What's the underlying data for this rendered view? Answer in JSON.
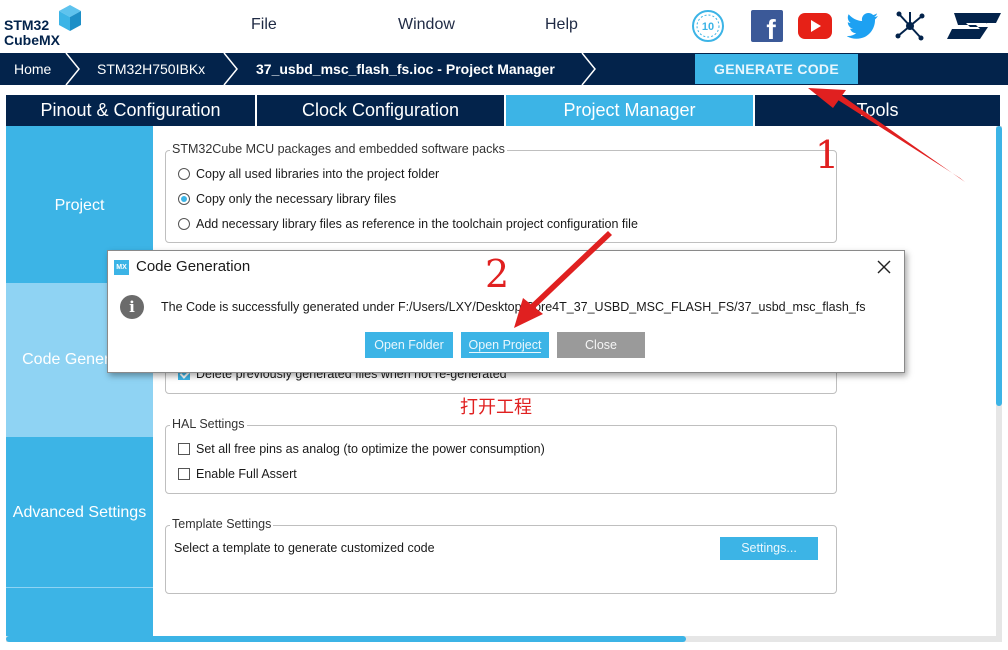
{
  "logo": {
    "line1": "STM32",
    "line2": "CubeMX"
  },
  "menu": {
    "file": "File",
    "window": "Window",
    "help": "Help"
  },
  "social": {
    "badge": "10",
    "facebook": "f",
    "st": "ST"
  },
  "breadcrumb": {
    "home": "Home",
    "device": "STM32H750IBKx",
    "project": "37_usbd_msc_flash_fs.ioc - Project Manager"
  },
  "toolbar": {
    "generate_label": "GENERATE CODE"
  },
  "tabs": [
    {
      "label": "Pinout & Configuration"
    },
    {
      "label": "Clock Configuration"
    },
    {
      "label": "Project Manager"
    },
    {
      "label": "Tools"
    }
  ],
  "sidenav": {
    "items": [
      {
        "label": "Project"
      },
      {
        "label": "Code Generator"
      },
      {
        "label": "Advanced Settings"
      }
    ]
  },
  "packages": {
    "title": "STM32Cube MCU packages and embedded software packs",
    "options": [
      {
        "label": "Copy all used libraries into the project folder",
        "selected": false
      },
      {
        "label": "Copy only the necessary library files",
        "selected": true
      },
      {
        "label": "Add necessary library files as reference in the toolchain project configuration file",
        "selected": false
      }
    ]
  },
  "generated_files": {
    "delete_label": "Delete previously generated files when not re-generated",
    "checked": true
  },
  "hal": {
    "title": "HAL Settings",
    "free_pins": "Set all free pins as analog (to optimize the power consumption)",
    "full_assert": "Enable Full Assert"
  },
  "template": {
    "title": "Template Settings",
    "description": "Select a template to generate customized code",
    "button": "Settings..."
  },
  "dialog": {
    "icon_text": "MX",
    "title": "Code Generation",
    "info": "i",
    "message": "The Code is successfully generated under F:/Users/LXY/Desktop/Core4T_37_USBD_MSC_FLASH_FS/37_usbd_msc_flash_fs",
    "open_folder": "Open Folder",
    "open_project": "Open Project",
    "close": "Close"
  },
  "annotations": {
    "step1": "1",
    "step2": "2",
    "note": "打开工程",
    "color": "#e02020"
  },
  "colors": {
    "navy": "#03234b",
    "accent": "#3cb4e6",
    "accent_light": "#8fd3f3"
  }
}
